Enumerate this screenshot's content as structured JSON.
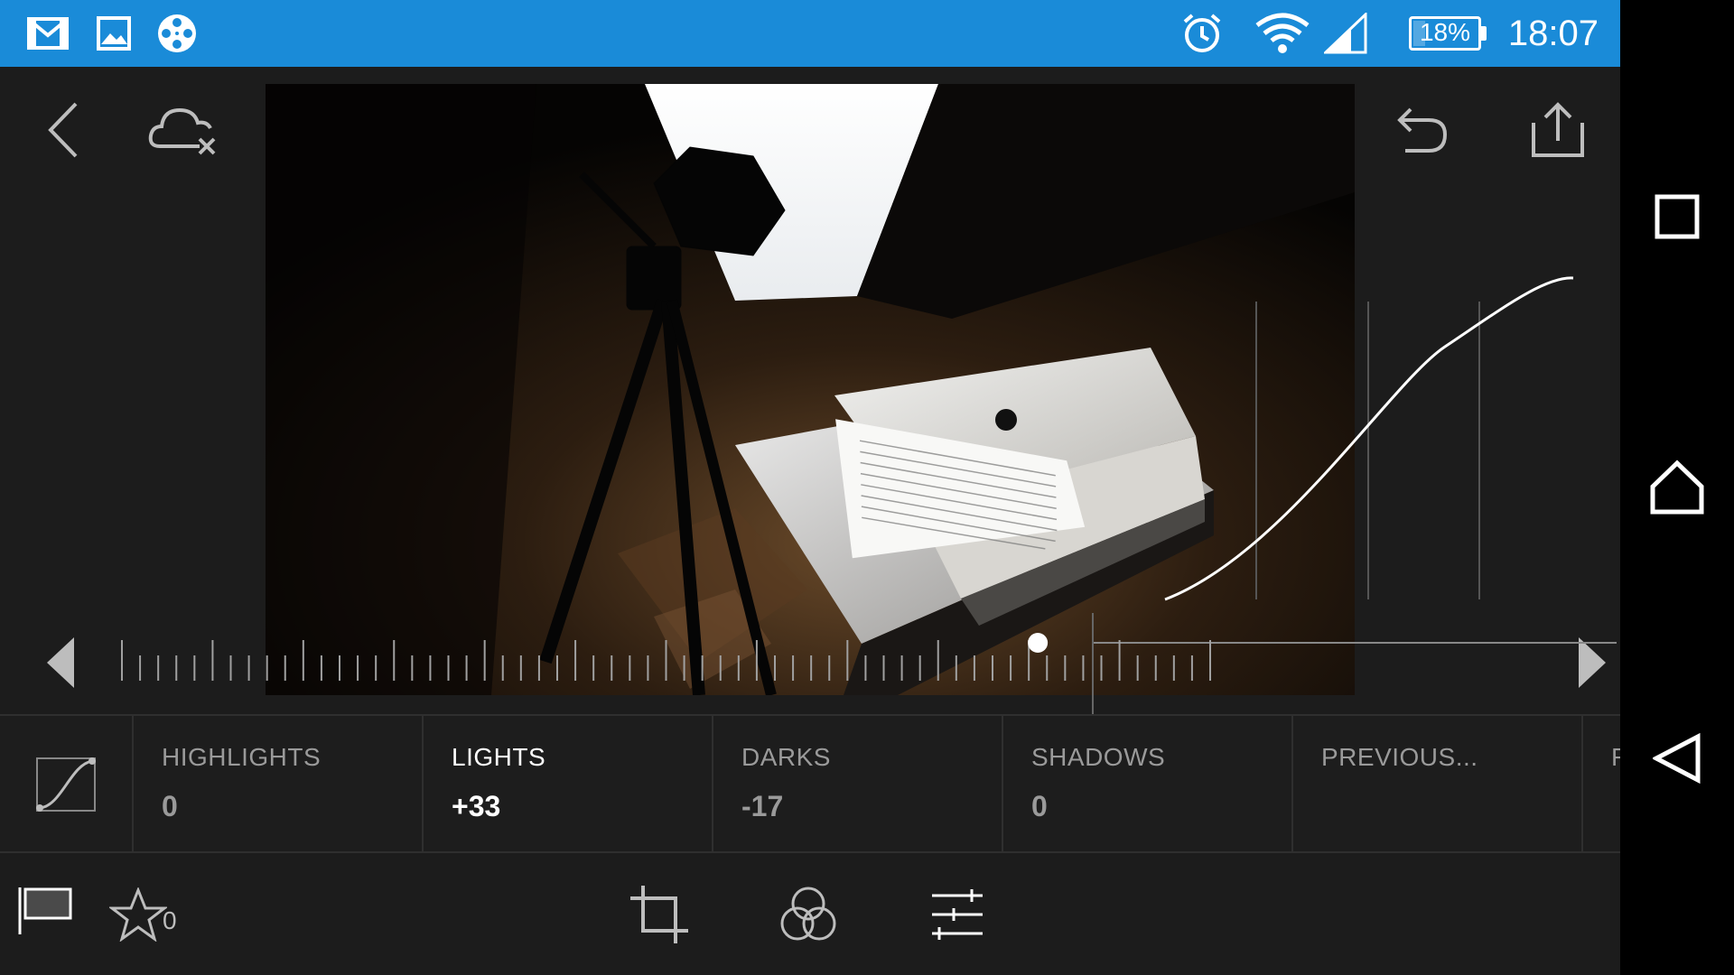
{
  "status_bar": {
    "time": "18:07",
    "battery_label": "18%",
    "battery_level": 0.18,
    "icons": [
      "gmail-icon",
      "gallery-icon",
      "film-reel-icon",
      "alarm-icon",
      "wifi-icon",
      "signal-icon",
      "battery-icon"
    ]
  },
  "toolbar": {
    "back_icon": "chevron-left-icon",
    "cloud_icon": "cloud-off-icon",
    "undo_icon": "undo-icon",
    "share_icon": "share-icon"
  },
  "tone_curve": {
    "active_adjustment": "lights"
  },
  "adjustments": [
    {
      "key": "highlights",
      "label": "HIGHLIGHTS",
      "value": "0",
      "active": false
    },
    {
      "key": "lights",
      "label": "LIGHTS",
      "value": "+33",
      "active": true
    },
    {
      "key": "darks",
      "label": "DARKS",
      "value": "-17",
      "active": false
    },
    {
      "key": "shadows",
      "label": "SHADOWS",
      "value": "0",
      "active": false
    },
    {
      "key": "previous",
      "label": "PREVIOUS...",
      "value": "",
      "active": false
    },
    {
      "key": "partial",
      "label": "F",
      "value": "",
      "active": false
    }
  ],
  "slider": {
    "value": 33,
    "min": -100,
    "max": 100
  },
  "bottom_bar": {
    "flag_icon": "flag-icon",
    "star_icon": "star-icon",
    "rating_count": "0",
    "crop_icon": "crop-icon",
    "presets_icon": "color-circles-icon",
    "adjust_icon": "sliders-icon"
  },
  "nav_bar": {
    "recents_icon": "square-icon",
    "home_icon": "home-icon",
    "back_icon": "triangle-back-icon"
  },
  "colors": {
    "status_bar": "#1a8bd8",
    "app_bg": "#1c1c1c",
    "active_text": "#ffffff",
    "inactive_text": "#9a9a9a"
  }
}
